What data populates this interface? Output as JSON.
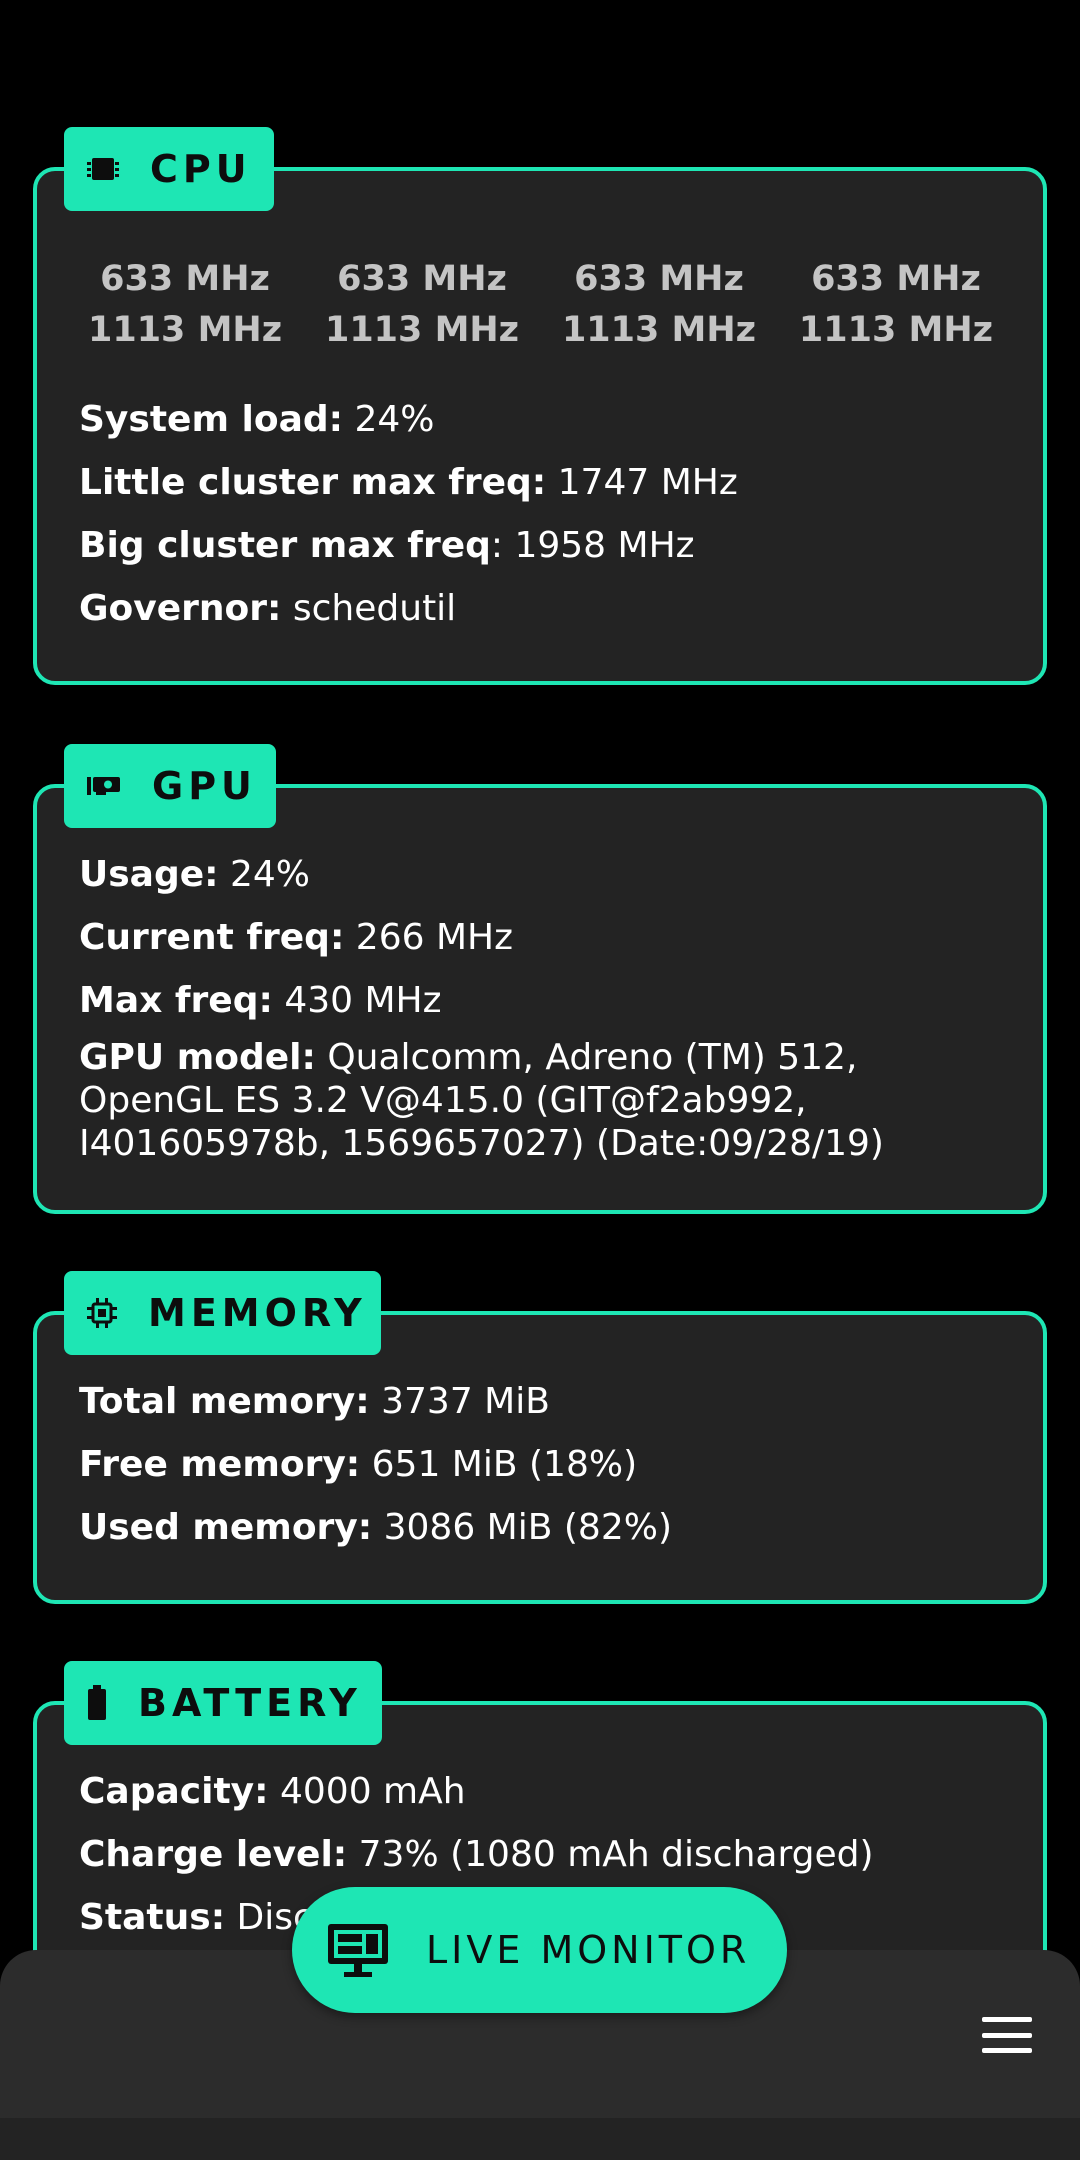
{
  "cpu": {
    "title": "CPU",
    "icon": "cpu-chip-icon",
    "cores": [
      {
        "min": "633 MHz",
        "max": "1113 MHz"
      },
      {
        "min": "633 MHz",
        "max": "1113 MHz"
      },
      {
        "min": "633 MHz",
        "max": "1113 MHz"
      },
      {
        "min": "633 MHz",
        "max": "1113 MHz"
      }
    ],
    "system_load": {
      "label": "System load:",
      "value": " 24%"
    },
    "little_max": {
      "label": "Little cluster max freq:",
      "value": " 1747 MHz"
    },
    "big_max": {
      "label": "Big cluster max freq",
      "value": ": 1958 MHz"
    },
    "governor": {
      "label": "Governor:",
      "value": " schedutil"
    }
  },
  "gpu": {
    "title": "GPU",
    "icon": "graphics-card-icon",
    "usage": {
      "label": "Usage:",
      "value": " 24%"
    },
    "current_freq": {
      "label": "Current freq:",
      "value": " 266 MHz"
    },
    "max_freq": {
      "label": "Max freq:",
      "value": " 430 MHz"
    },
    "model": {
      "label": "GPU model:",
      "value": " Qualcomm, Adreno (TM) 512, OpenGL ES 3.2 V@415.0 (GIT@f2ab992, I401605978b, 1569657027) (Date:09/28/19)"
    }
  },
  "memory": {
    "title": "MEMORY",
    "icon": "memory-chip-icon",
    "total": {
      "label": "Total memory:",
      "value": " 3737 MiB"
    },
    "free": {
      "label": "Free memory:",
      "value": " 651 MiB (18%)"
    },
    "used": {
      "label": "Used memory:",
      "value": " 3086 MiB (82%)"
    }
  },
  "battery": {
    "title": "BATTERY",
    "icon": "battery-icon",
    "capacity": {
      "label": "Capacity:",
      "value": " 4000 mAh"
    },
    "charge": {
      "label": "Charge level:",
      "value": " 73% (1080 mAh discharged)"
    },
    "status": {
      "label": "Status:",
      "value": " Disc"
    }
  },
  "fab": {
    "label": "LIVE MONITOR",
    "icon": "monitor-icon"
  },
  "menu": {
    "icon": "hamburger-menu-icon"
  },
  "colors": {
    "accent": "#1ee6b4",
    "card_bg": "#232323",
    "page_bg": "#000000",
    "bar_bg": "#2c2c2c"
  }
}
